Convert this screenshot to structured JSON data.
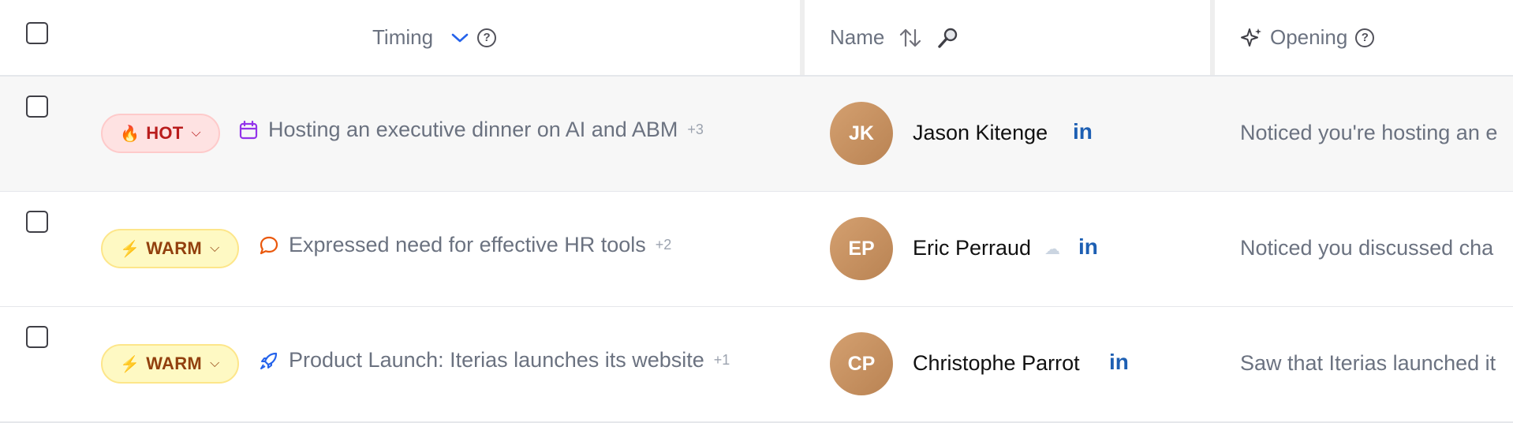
{
  "header": {
    "timing_label": "Timing",
    "name_label": "Name",
    "opening_label": "Opening",
    "help_glyph": "?"
  },
  "rows": [
    {
      "intent": "HOT",
      "intent_emoji": "🔥",
      "signal_icon": "calendar-icon",
      "signal_text": "Hosting an executive dinner on AI and ABM",
      "signal_more": "+3",
      "initials": "JK",
      "name": "Jason Kitenge",
      "linkedin": "in",
      "opening": "Noticed you're hosting an e"
    },
    {
      "intent": "WARM",
      "intent_emoji": "⚡",
      "signal_icon": "chat-bubble-icon",
      "signal_text": "Expressed need for effective HR tools",
      "signal_more": "+2",
      "initials": "EP",
      "name": "Eric Perraud",
      "linkedin": "in",
      "opening": "Noticed you discussed cha"
    },
    {
      "intent": "WARM",
      "intent_emoji": "⚡",
      "signal_icon": "rocket-icon",
      "signal_text": "Product Launch: Iterias launches its website",
      "signal_more": "+1",
      "initials": "CP",
      "name": "Christophe Parrot",
      "linkedin": "in",
      "opening": "Saw that Iterias launched it"
    }
  ],
  "colors": {
    "hot_bg": "#fee2e2",
    "hot_text": "#b91c1c",
    "warm_bg": "#fef9c3",
    "warm_text": "#92400e",
    "linkedin": "#1d5fb3",
    "avatar": "#c58d5e"
  }
}
